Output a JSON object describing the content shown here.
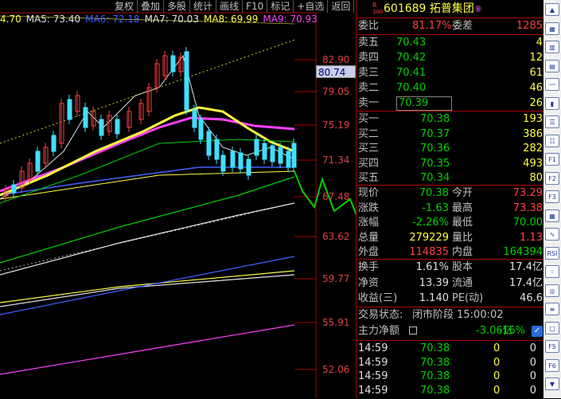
{
  "toolbar": {
    "items": [
      "复权",
      "叠加",
      "多股",
      "统计",
      "画线",
      "F10",
      "标记",
      "+自选",
      "返回"
    ]
  },
  "ma_legend": [
    {
      "text": "4.70",
      "color": "#ffff40"
    },
    {
      "text": "MA5: 73.40",
      "color": "#e0e0e0"
    },
    {
      "text": "MA6: 72.18",
      "color": "#4060ff"
    },
    {
      "text": "MA7: 70.03",
      "color": "#e0e0e0"
    },
    {
      "text": "MA8: 69.99",
      "color": "#ffff40"
    },
    {
      "text": "MA9: 70.93",
      "color": "#ff40ff"
    }
  ],
  "price_axis": [
    "82.90",
    "79.05",
    "75.19",
    "71.34",
    "67.48",
    "63.62",
    "59.77",
    "55.91",
    "52.06"
  ],
  "current_price": "80.74",
  "stock": {
    "badge_r": "R",
    "badge_num": "300",
    "code": "601689",
    "name": "拓普集团",
    "circle": "⑧"
  },
  "weibi": {
    "label": "委比",
    "value": "81.17%",
    "label2": "委差",
    "value2": "1285"
  },
  "asks": [
    {
      "label": "卖五",
      "price": "70.43",
      "vol": "4"
    },
    {
      "label": "卖四",
      "price": "70.42",
      "vol": "12"
    },
    {
      "label": "卖三",
      "price": "70.41",
      "vol": "61"
    },
    {
      "label": "卖二",
      "price": "70.40",
      "vol": "46"
    },
    {
      "label": "卖一",
      "price": "70.39",
      "vol": "26"
    }
  ],
  "bids": [
    {
      "label": "买一",
      "price": "70.38",
      "vol": "193"
    },
    {
      "label": "买二",
      "price": "70.37",
      "vol": "386"
    },
    {
      "label": "买三",
      "price": "70.36",
      "vol": "282"
    },
    {
      "label": "买四",
      "price": "70.35",
      "vol": "493"
    },
    {
      "label": "买五",
      "price": "70.34",
      "vol": "80"
    }
  ],
  "stats": [
    {
      "l1": "现价",
      "v1": "70.38",
      "c1": "green",
      "l2": "今开",
      "v2": "73.29",
      "c2": "red"
    },
    {
      "l1": "涨跌",
      "v1": "-1.63",
      "c1": "green",
      "l2": "最高",
      "v2": "73.38",
      "c2": "red"
    },
    {
      "l1": "涨幅",
      "v1": "-2.26%",
      "c1": "green",
      "l2": "最低",
      "v2": "70.00",
      "c2": "green"
    },
    {
      "l1": "总量",
      "v1": "279229",
      "c1": "yellow",
      "l2": "量比",
      "v2": "1.13",
      "c2": "red"
    },
    {
      "l1": "外盘",
      "v1": "114835",
      "c1": "red",
      "l2": "内盘",
      "v2": "164394",
      "c2": "green"
    }
  ],
  "fundamentals": [
    {
      "l1": "换手",
      "v1": "1.61%",
      "l2": "股本",
      "v2": "17.4亿"
    },
    {
      "l1": "净资",
      "v1": "13.39",
      "l2": "流通",
      "v2": "17.4亿"
    },
    {
      "l1": "收益(三)",
      "v1": "1.140",
      "l2": "PE(动)",
      "v2": "46.6"
    }
  ],
  "trade_status": {
    "label": "交易状态:",
    "value": "闭市阶段 15:00:02"
  },
  "main_force": {
    "label": "主力净额",
    "value": "-3.06亿",
    "pct": "-16%"
  },
  "ticks": [
    {
      "time": "14:59",
      "price": "70.38",
      "vol": "0",
      "dir": "0"
    },
    {
      "time": "14:59",
      "price": "70.38",
      "vol": "0",
      "dir": "0"
    },
    {
      "time": "14:59",
      "price": "70.38",
      "vol": "0",
      "dir": "0"
    },
    {
      "time": "14:59",
      "price": "70.38",
      "vol": "0",
      "dir": "0"
    }
  ],
  "sidebar_icons": [
    "chevron-up",
    "book",
    "chart",
    "grid",
    "line",
    "candle",
    "list",
    "list2",
    "F1",
    "F2",
    "F3",
    "grid2",
    "wave",
    "RSI",
    "dots",
    "ring",
    "list3",
    "doc",
    "F5",
    "F6",
    "chevron-down"
  ]
}
